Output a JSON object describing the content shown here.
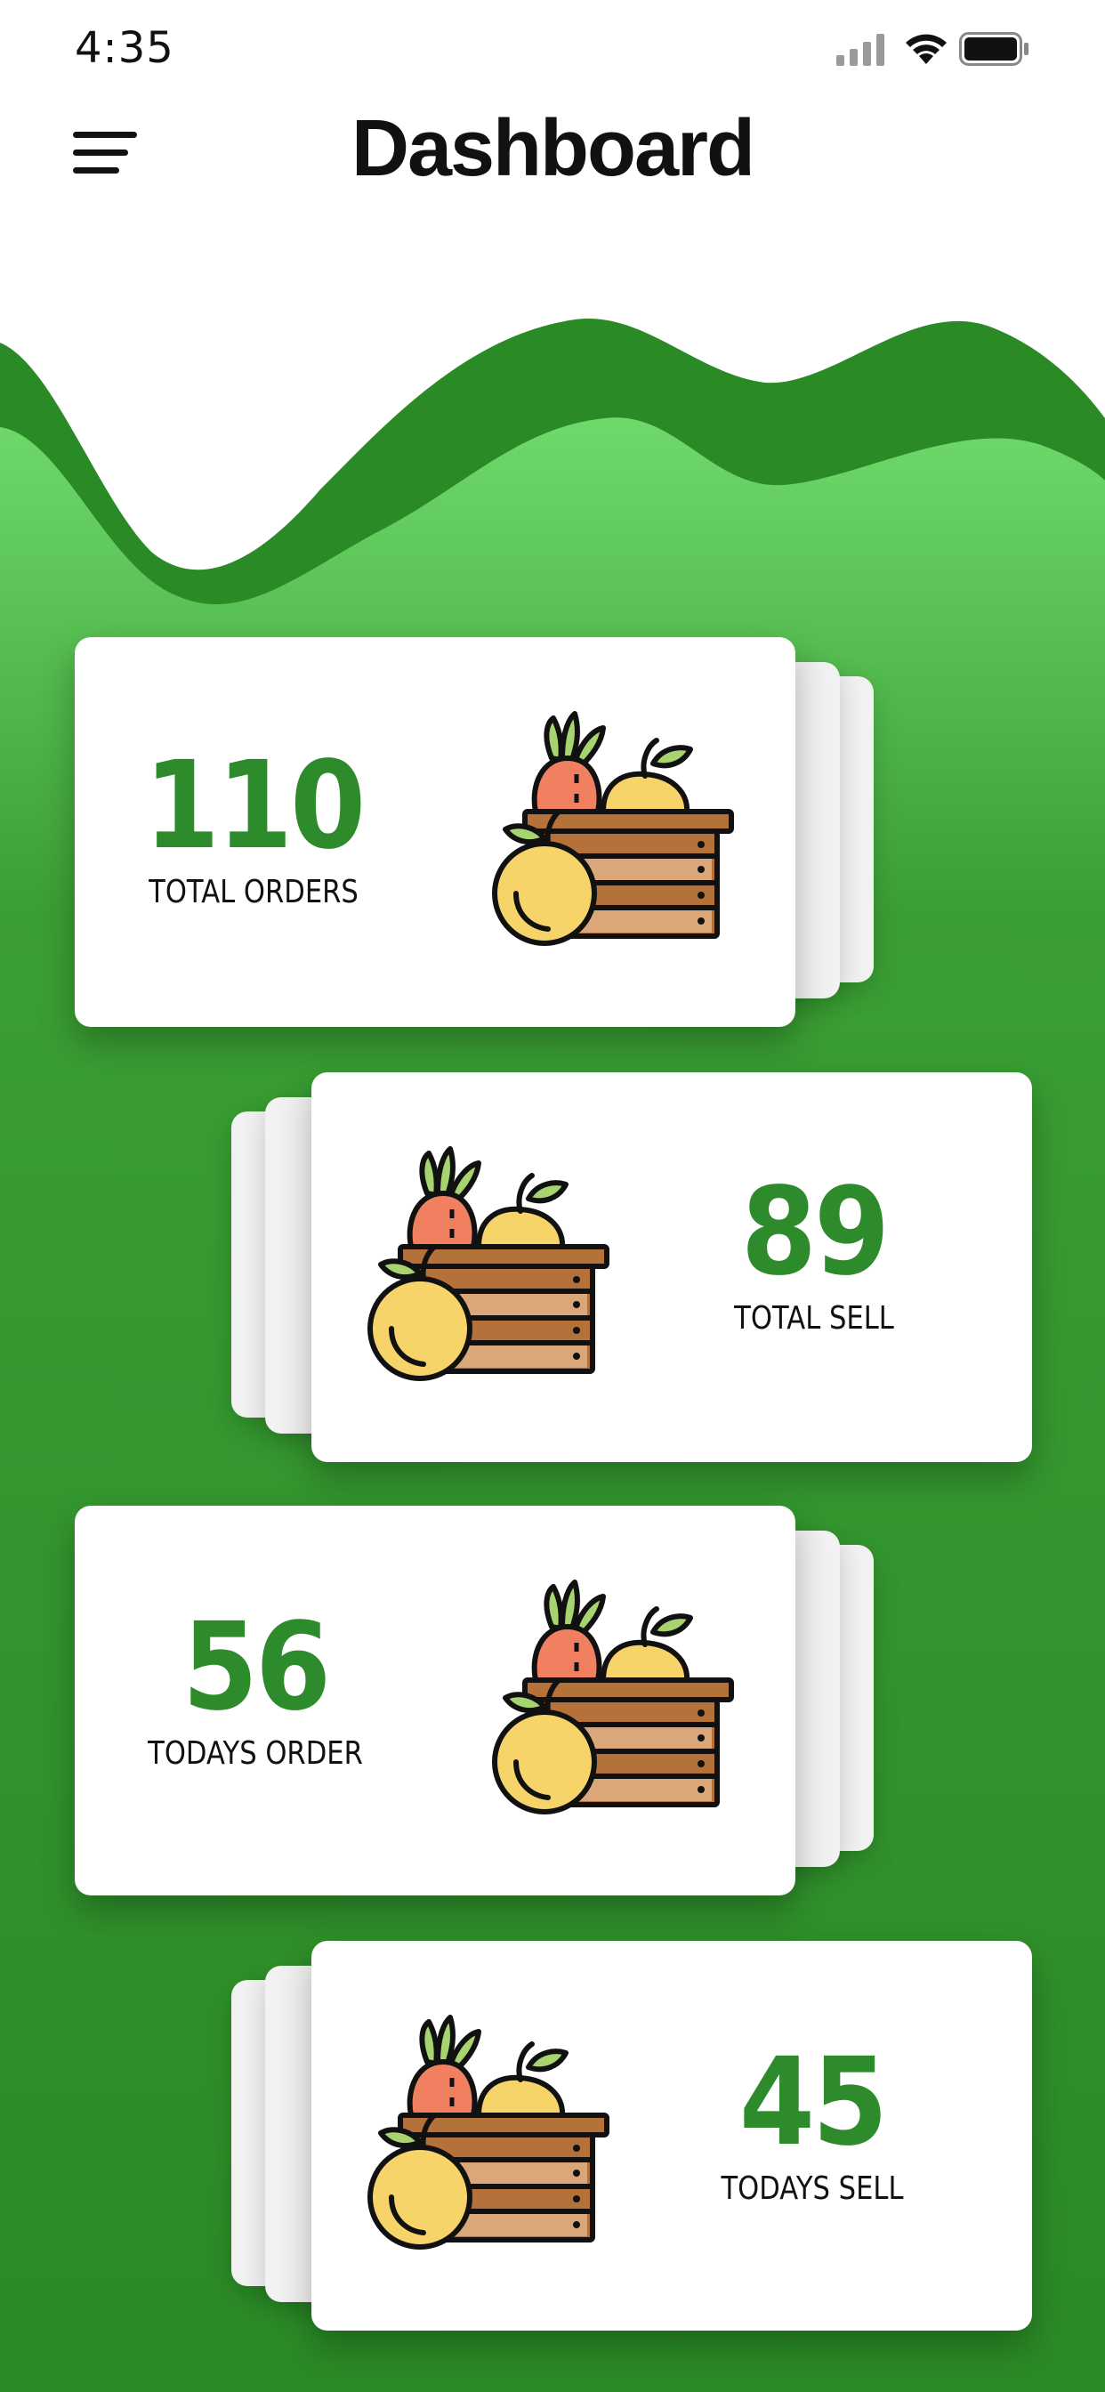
{
  "status_bar": {
    "time": "4:35"
  },
  "header": {
    "title": "Dashboard",
    "menu_icon": "hamburger-menu-icon"
  },
  "colors": {
    "dark_green": "#2a8a26",
    "light_green": "#66d066",
    "value_green": "#2e8b2c"
  },
  "cards": [
    {
      "value": "110",
      "label": "TOTAL ORDERS",
      "icon": "fruit-crate-icon"
    },
    {
      "value": "89",
      "label": "TOTAL SELL",
      "icon": "fruit-crate-icon"
    },
    {
      "value": "56",
      "label": "TODAYS ORDER",
      "icon": "fruit-crate-icon"
    },
    {
      "value": "45",
      "label": "TODAYS SELL",
      "icon": "fruit-crate-icon"
    }
  ]
}
